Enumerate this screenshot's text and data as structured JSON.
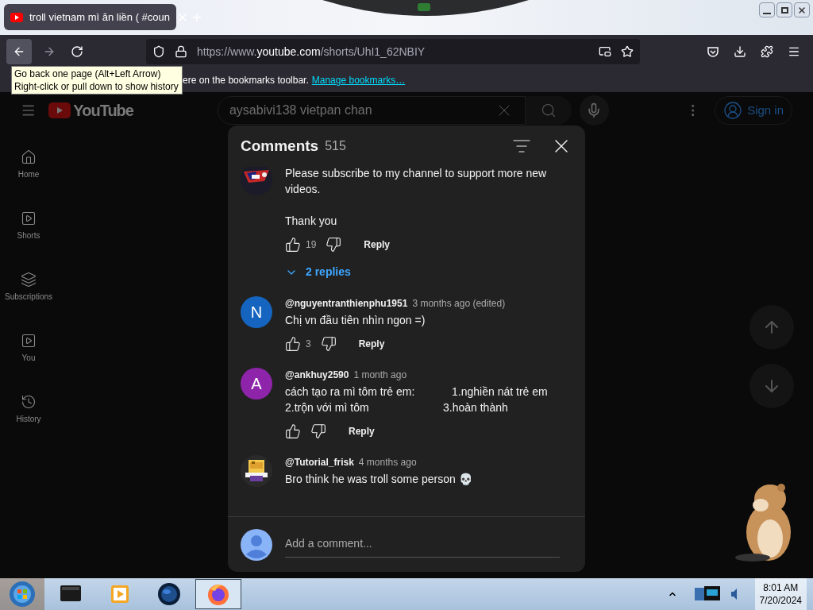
{
  "browser": {
    "tab": {
      "title": "troll vietnam mì ăn liền ( #coun",
      "selected": true
    },
    "url": {
      "prefix": "https://www.",
      "domain": "youtube.com",
      "path": "/shorts/UhI1_62NBIY"
    },
    "bookmarks_bar": {
      "text": "ere on the bookmarks toolbar.",
      "link": "Manage bookmarks…"
    },
    "tooltip": {
      "lines": [
        "Go back one page (Alt+Left Arrow)",
        "Right-click or pull down to show history"
      ]
    }
  },
  "youtube": {
    "logo": "YouTube",
    "search": {
      "value": "aysabivi138 vietpan chan"
    },
    "sign_in": "Sign in",
    "sidebar": [
      {
        "kind": "home",
        "label": "Home"
      },
      {
        "kind": "shorts",
        "label": "Shorts"
      },
      {
        "kind": "subscriptions",
        "label": "Subscriptions"
      },
      {
        "kind": "you",
        "label": "You"
      },
      {
        "kind": "history",
        "label": "History"
      }
    ],
    "comments_panel": {
      "title": "Comments",
      "count": "515",
      "comments": [
        {
          "avatar": {
            "kind": "picture"
          },
          "paragraphs": [
            "Please subscribe to my channel to support more new videos.",
            "Thank you"
          ],
          "likes": "19",
          "reply": "Reply",
          "replies": "2 replies"
        },
        {
          "avatar": {
            "kind": "letter",
            "letter": "N",
            "color": "#1565c0"
          },
          "author": "@nguyentranthienphu1951",
          "time": "3 months ago (edited)",
          "paragraphs": [
            "Chị vn đầu tiên nhìn ngon =)"
          ],
          "likes": "3",
          "reply": "Reply"
        },
        {
          "avatar": {
            "kind": "letter",
            "letter": "A",
            "color": "#8e24aa"
          },
          "author": "@ankhuy2590",
          "time": "1 month ago",
          "paragraphs": [
            "cách tạo ra mì tôm trẻ em:            1.nghiền nát trẻ em 2.trộn với mì tôm                        3.hoàn thành"
          ],
          "reply": "Reply"
        },
        {
          "avatar": {
            "kind": "picture"
          },
          "author": "@Tutorial_frisk",
          "time": "4 months ago",
          "paragraphs": [
            "Bro think he was troll some person 💀"
          ]
        }
      ],
      "input": {
        "placeholder": "Add a comment..."
      }
    }
  },
  "taskbar": {
    "apps": [
      {
        "kind": "terminal",
        "selected": false
      },
      {
        "kind": "media",
        "selected": false
      },
      {
        "kind": "globe",
        "selected": false
      },
      {
        "kind": "firefox",
        "selected": true
      }
    ],
    "time": "8:01 AM",
    "date": "7/20/2024"
  }
}
